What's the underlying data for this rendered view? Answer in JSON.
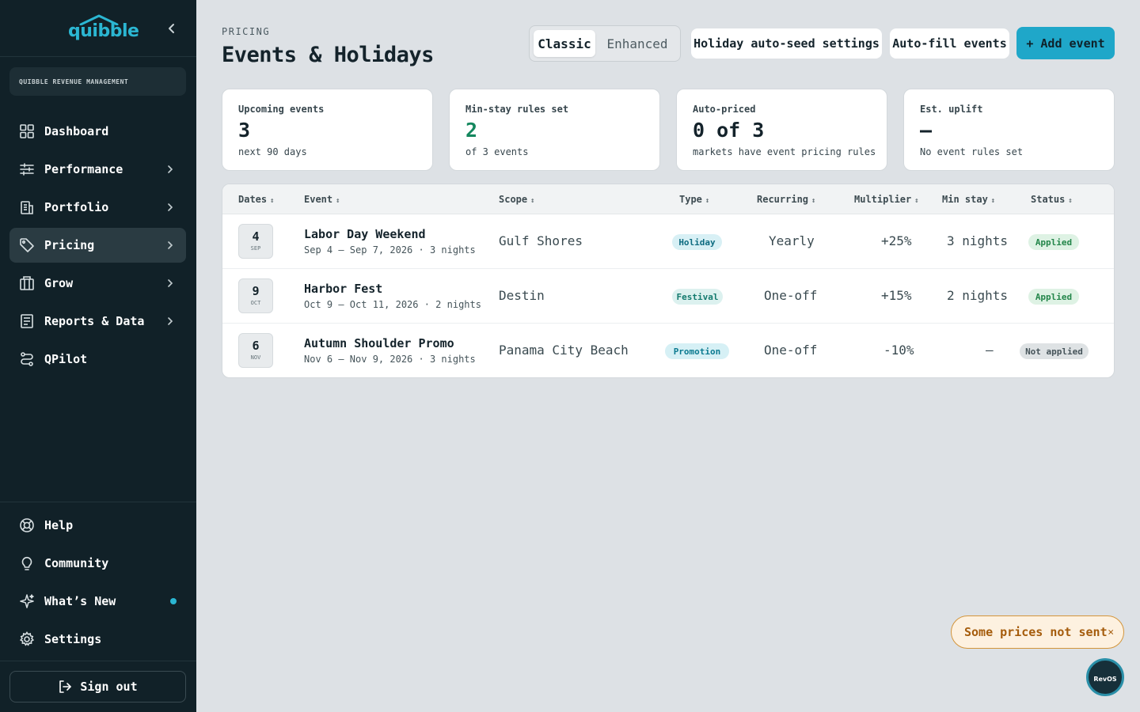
{
  "brand": {
    "logo": "quibble",
    "org": "QUIBBLE REVENUE MANAGEMENT"
  },
  "sidebar": {
    "items": [
      {
        "label": "Dashboard",
        "icon": "grid-icon"
      },
      {
        "label": "Performance",
        "icon": "sliders-icon"
      },
      {
        "label": "Portfolio",
        "icon": "building-icon"
      },
      {
        "label": "Pricing",
        "icon": "tag-icon"
      },
      {
        "label": "Grow",
        "icon": "columns-icon"
      },
      {
        "label": "Reports & Data",
        "icon": "report-icon"
      },
      {
        "label": "QPilot",
        "icon": "route-icon"
      }
    ],
    "bottom": [
      {
        "label": "Help",
        "icon": "lifebuoy-icon"
      },
      {
        "label": "Community",
        "icon": "lightbulb-icon"
      },
      {
        "label": "What’s New",
        "icon": "sparkles-icon"
      },
      {
        "label": "Settings",
        "icon": "gear-icon"
      }
    ],
    "signout": "Sign out",
    "accent": "#2bb6d2"
  },
  "header": {
    "eyebrow": "PRICING",
    "title": "Events & Holidays",
    "view_classic": "Classic",
    "view_enhanced": "Enhanced",
    "holiday_btn": "Holiday auto-seed settings",
    "autofill_btn": "Auto-fill events",
    "add_btn": "+ Add event"
  },
  "stats": [
    {
      "label": "Upcoming events",
      "value": "3",
      "sub": "next 90 days"
    },
    {
      "label": "Min-stay rules set",
      "value": "2",
      "sub": "of 3 events"
    },
    {
      "label": "Auto-priced",
      "value": "0 of 3",
      "sub": "markets have event pricing rules"
    },
    {
      "label": "Est. uplift",
      "value": "—",
      "sub": "No event rules set"
    }
  ],
  "table": {
    "columns": [
      "Dates",
      "Event",
      "Scope",
      "Type",
      "Recurring",
      "Multiplier",
      "Min stay",
      "Status"
    ],
    "rows": [
      {
        "day": "4",
        "mon": "SEP",
        "name": "Labor Day Weekend",
        "range": "Sep 4 – Sep 7, 2026 · 3 nights",
        "scope": "Gulf Shores",
        "type": "Holiday",
        "recurring": "Yearly",
        "multiplier": "+25%",
        "min_stay": "3 nights",
        "status": "Applied"
      },
      {
        "day": "9",
        "mon": "OCT",
        "name": "Harbor Fest",
        "range": "Oct 9 – Oct 11, 2026 · 2 nights",
        "scope": "Destin",
        "type": "Festival",
        "recurring": "One-off",
        "multiplier": "+15%",
        "min_stay": "2 nights",
        "status": "Applied"
      },
      {
        "day": "6",
        "mon": "NOV",
        "name": "Autumn Shoulder Promo",
        "range": "Nov 6 – Nov 9, 2026 · 3 nights",
        "scope": "Panama City Beach",
        "type": "Promotion",
        "recurring": "One-off",
        "multiplier": "-10%",
        "min_stay": "—",
        "status": "Not applied"
      }
    ]
  },
  "toast": {
    "text": "Some prices not sent"
  },
  "fab": {
    "label": "RevOS"
  }
}
